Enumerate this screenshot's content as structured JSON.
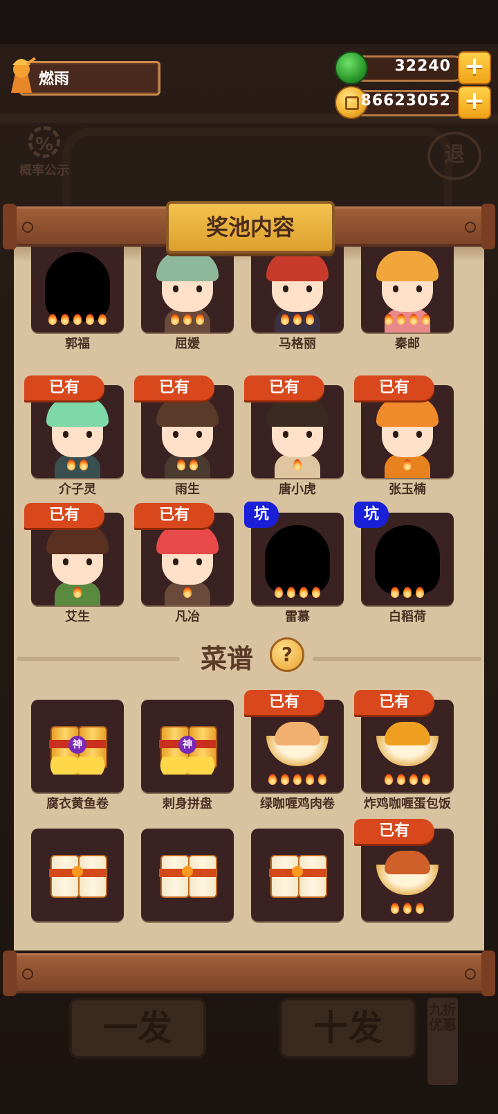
{
  "player": {
    "name": "燃雨"
  },
  "currency": {
    "jade": "32240",
    "coins": "86623052",
    "add_label": "+"
  },
  "side": {
    "probability_label": "概率公示",
    "probability_icon": "%",
    "exit_label": "退"
  },
  "panel": {
    "title": "奖池内容"
  },
  "tags": {
    "owned": "已有",
    "pit": "坑",
    "divine": "神"
  },
  "characters": [
    {
      "name": "郭福",
      "stars": 5,
      "tag": "",
      "hidden": true
    },
    {
      "name": "屈媛",
      "stars": 3,
      "tag": "",
      "hidden": false,
      "hair": "#8db89a",
      "body": "#6a4a3a"
    },
    {
      "name": "马格丽",
      "stars": 3,
      "tag": "",
      "hidden": false,
      "hair": "#c83a2a",
      "body": "#3a3040"
    },
    {
      "name": "秦邮",
      "stars": 4,
      "tag": "",
      "hidden": false,
      "hair": "#f0a63a",
      "body": "#e88a8a"
    },
    {
      "name": "介子灵",
      "stars": 2,
      "tag": "已有",
      "hidden": false,
      "hair": "#7ed8a8",
      "body": "#3a5050"
    },
    {
      "name": "雨生",
      "stars": 2,
      "tag": "已有",
      "hidden": false,
      "hair": "#5a3a28",
      "body": "#4a3a30"
    },
    {
      "name": "唐小虎",
      "stars": 1,
      "tag": "已有",
      "hidden": false,
      "hair": "#3a2a20",
      "body": "#e0c6a0"
    },
    {
      "name": "张玉楠",
      "stars": 1,
      "tag": "已有",
      "hidden": false,
      "hair": "#f08a2a",
      "body": "#e8821e"
    },
    {
      "name": "艾生",
      "stars": 1,
      "tag": "已有",
      "hidden": false,
      "hair": "#5a3020",
      "body": "#5a8a40"
    },
    {
      "name": "凡冶",
      "stars": 1,
      "tag": "已有",
      "hidden": false,
      "hair": "#e84a4a",
      "body": "#6a4a3a"
    },
    {
      "name": "雷慕",
      "stars": 4,
      "tag": "坑",
      "hidden": true
    },
    {
      "name": "白稻荷",
      "stars": 3,
      "tag": "坑",
      "hidden": true
    }
  ],
  "recipes": {
    "title": "菜谱",
    "help_icon": "?",
    "items": [
      {
        "name": "腐衣黄鱼卷",
        "stars": 0,
        "tag": "",
        "kind": "divine-box"
      },
      {
        "name": "刺身拼盘",
        "stars": 0,
        "tag": "",
        "kind": "divine-box"
      },
      {
        "name": "绿咖喱鸡肉卷",
        "stars": 5,
        "tag": "已有",
        "kind": "dish",
        "color": "#f2b070"
      },
      {
        "name": "炸鸡咖喱蛋包饭",
        "stars": 4,
        "tag": "已有",
        "kind": "dish",
        "color": "#f0a020"
      },
      {
        "name": "",
        "stars": 0,
        "tag": "",
        "kind": "plain-box"
      },
      {
        "name": "",
        "stars": 0,
        "tag": "",
        "kind": "plain-box"
      },
      {
        "name": "",
        "stars": 0,
        "tag": "",
        "kind": "plain-box"
      },
      {
        "name": "",
        "stars": 3,
        "tag": "已有",
        "kind": "dish",
        "color": "#d0602a"
      }
    ]
  },
  "background_buttons": {
    "single": "一发",
    "ten": "十发",
    "discount": "九折优惠"
  }
}
